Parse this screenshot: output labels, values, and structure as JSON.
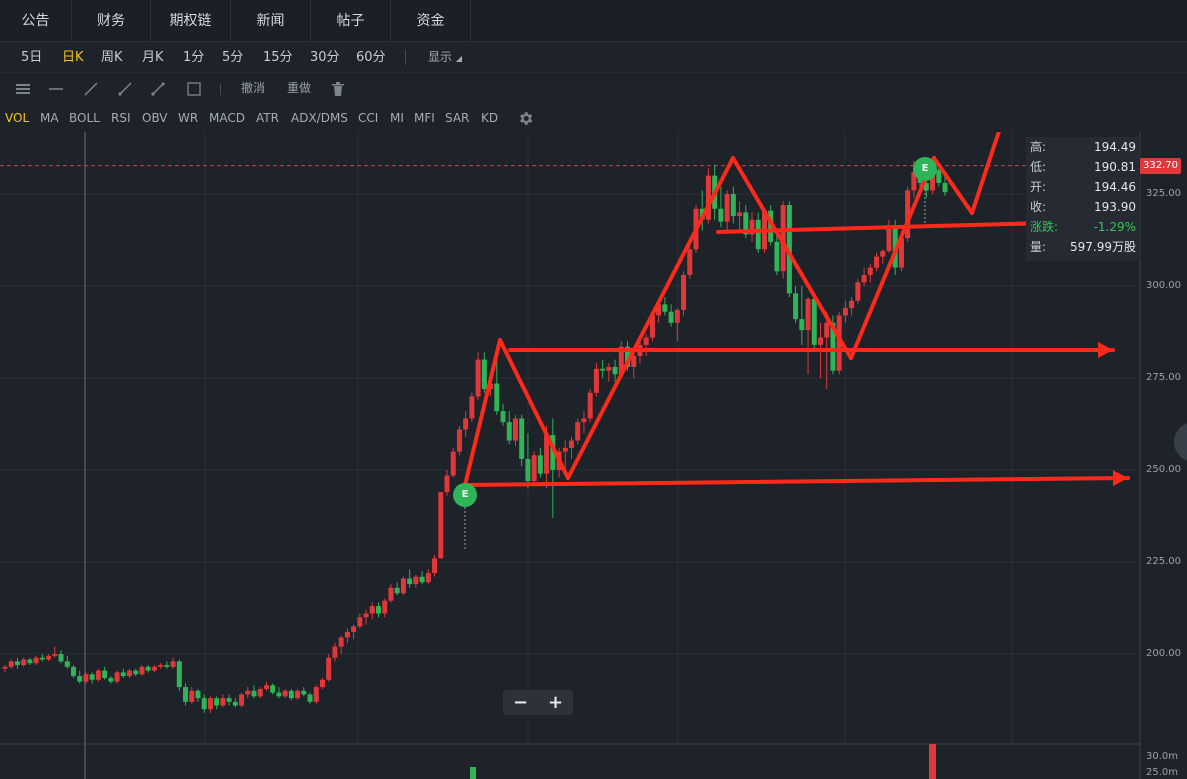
{
  "nav": {
    "tabs": [
      "公告",
      "财务",
      "期权链",
      "新闻",
      "帖子",
      "资金"
    ]
  },
  "periods": {
    "items": [
      "5日",
      "日K",
      "周K",
      "月K",
      "1分",
      "5分",
      "15分",
      "30分",
      "60分"
    ],
    "active": "日K",
    "display_label": "显示"
  },
  "drawtools": {
    "undo": "撤消",
    "redo": "重做"
  },
  "indicators": {
    "items": [
      "VOL",
      "MA",
      "BOLL",
      "RSI",
      "OBV",
      "WR",
      "MACD",
      "ATR",
      "ADX/DMS",
      "CCI",
      "MI",
      "MFI",
      "SAR",
      "KD"
    ],
    "active": "VOL"
  },
  "info": {
    "high_label": "高:",
    "high": "194.49",
    "low_label": "低:",
    "low": "190.81",
    "open_label": "开:",
    "open": "194.46",
    "close_label": "收:",
    "close": "193.90",
    "change_label": "涨跌:",
    "change": "-1.29%",
    "volume_label": "量:",
    "volume": "597.99万股"
  },
  "price_tag": "332.70",
  "yaxis": {
    "ticks": [
      "325.00",
      "300.00",
      "275.00",
      "250.00",
      "225.00",
      "200.00"
    ],
    "volume_ticks": [
      "30.0m",
      "25.0m"
    ]
  },
  "markers": {
    "earnings": "E"
  },
  "zoom": {
    "minus": "−",
    "plus": "+"
  },
  "colors": {
    "up": "#e0383a",
    "down": "#2fb457",
    "annotation": "#ff2a1a",
    "background": "#1e2229"
  },
  "chart_data": {
    "type": "candlestick",
    "ylim": [
      180,
      337
    ],
    "yticks": [
      200,
      225,
      250,
      275,
      300,
      325
    ],
    "reference_price": 332.7,
    "candles": [
      [
        196.0,
        197.0,
        195.0,
        196.5
      ],
      [
        196.5,
        198.5,
        196.0,
        198.0
      ],
      [
        198.0,
        199.0,
        196.0,
        197.0
      ],
      [
        197.0,
        199.0,
        196.5,
        198.5
      ],
      [
        198.5,
        199.0,
        197.0,
        197.5
      ],
      [
        197.5,
        199.5,
        197.0,
        199.0
      ],
      [
        199.0,
        200.0,
        198.0,
        198.5
      ],
      [
        198.5,
        200.0,
        198.0,
        199.5
      ],
      [
        199.5,
        202.0,
        199.0,
        200.0
      ],
      [
        200.0,
        201.0,
        197.5,
        198.0
      ],
      [
        198.0,
        199.5,
        196.0,
        196.5
      ],
      [
        196.5,
        197.0,
        193.5,
        194.0
      ],
      [
        194.0,
        195.5,
        192.0,
        192.5
      ],
      [
        192.5,
        195.0,
        192.0,
        194.5
      ],
      [
        194.5,
        195.0,
        192.0,
        193.0
      ],
      [
        193.0,
        196.0,
        192.5,
        195.5
      ],
      [
        195.5,
        196.5,
        193.0,
        193.5
      ],
      [
        193.5,
        194.0,
        192.0,
        192.5
      ],
      [
        192.5,
        195.5,
        192.0,
        195.0
      ],
      [
        195.0,
        196.0,
        193.5,
        194.0
      ],
      [
        194.0,
        196.0,
        193.5,
        195.5
      ],
      [
        195.5,
        196.0,
        194.0,
        194.5
      ],
      [
        194.5,
        197.0,
        194.0,
        196.5
      ],
      [
        196.5,
        197.0,
        195.0,
        195.5
      ],
      [
        195.5,
        197.0,
        195.0,
        196.5
      ],
      [
        196.5,
        197.5,
        196.0,
        197.0
      ],
      [
        197.0,
        198.0,
        196.0,
        196.5
      ],
      [
        196.5,
        199.0,
        196.0,
        198.0
      ],
      [
        198.0,
        198.5,
        190.0,
        191.0
      ],
      [
        191.0,
        192.0,
        186.0,
        187.0
      ],
      [
        187.0,
        191.0,
        186.5,
        190.0
      ],
      [
        190.0,
        190.5,
        187.0,
        188.0
      ],
      [
        188.0,
        189.0,
        184.0,
        185.0
      ],
      [
        185.0,
        188.5,
        184.0,
        188.0
      ],
      [
        188.0,
        188.5,
        185.0,
        186.0
      ],
      [
        186.0,
        189.0,
        185.5,
        188.0
      ],
      [
        188.0,
        189.0,
        186.0,
        187.0
      ],
      [
        187.0,
        188.0,
        185.5,
        186.0
      ],
      [
        186.0,
        189.5,
        185.5,
        189.0
      ],
      [
        189.0,
        191.0,
        188.0,
        190.0
      ],
      [
        190.0,
        191.5,
        188.0,
        188.5
      ],
      [
        188.5,
        191.0,
        188.0,
        190.5
      ],
      [
        190.5,
        192.5,
        190.0,
        191.5
      ],
      [
        191.5,
        192.0,
        189.0,
        189.5
      ],
      [
        189.5,
        191.0,
        188.0,
        188.5
      ],
      [
        188.5,
        190.5,
        188.0,
        190.0
      ],
      [
        190.0,
        190.5,
        187.5,
        188.0
      ],
      [
        188.0,
        190.5,
        187.5,
        190.0
      ],
      [
        190.0,
        191.0,
        188.5,
        189.0
      ],
      [
        189.0,
        189.5,
        186.5,
        187.0
      ],
      [
        187.0,
        191.5,
        186.5,
        191.0
      ],
      [
        191.0,
        193.5,
        190.5,
        193.0
      ],
      [
        193.0,
        200.0,
        192.5,
        199.0
      ],
      [
        199.0,
        203.0,
        198.0,
        202.0
      ],
      [
        202.0,
        205.0,
        200.0,
        204.5
      ],
      [
        204.5,
        207.0,
        203.0,
        206.0
      ],
      [
        206.0,
        208.0,
        204.0,
        207.5
      ],
      [
        207.5,
        211.0,
        207.0,
        210.0
      ],
      [
        210.0,
        212.0,
        208.0,
        211.0
      ],
      [
        211.0,
        214.0,
        209.5,
        213.0
      ],
      [
        213.0,
        214.0,
        210.0,
        211.0
      ],
      [
        211.0,
        215.0,
        210.0,
        214.5
      ],
      [
        214.5,
        219.0,
        214.0,
        218.0
      ],
      [
        218.0,
        219.5,
        216.0,
        216.5
      ],
      [
        216.5,
        221.0,
        216.0,
        220.5
      ],
      [
        220.5,
        223.0,
        218.0,
        219.0
      ],
      [
        219.0,
        221.5,
        218.0,
        221.0
      ],
      [
        221.0,
        222.5,
        219.0,
        219.5
      ],
      [
        219.5,
        223.0,
        219.0,
        222.0
      ],
      [
        222.0,
        227.0,
        221.0,
        226.0
      ],
      [
        226.0,
        226.5,
        244.0,
        244.0
      ],
      [
        244.0,
        250.0,
        243.0,
        248.5
      ],
      [
        248.5,
        256.0,
        248.0,
        255.0
      ],
      [
        255.0,
        262.0,
        254.0,
        261.0
      ],
      [
        261.0,
        266.0,
        259.0,
        264.0
      ],
      [
        264.0,
        271.0,
        263.0,
        270.0
      ],
      [
        270.0,
        282.0,
        269.0,
        280.0
      ],
      [
        280.0,
        282.0,
        271.0,
        272.0
      ],
      [
        272.0,
        275.0,
        270.0,
        273.5
      ],
      [
        273.5,
        282.0,
        265.0,
        266.0
      ],
      [
        266.0,
        268.0,
        262.0,
        263.0
      ],
      [
        263.0,
        266.0,
        257.0,
        258.0
      ],
      [
        258.0,
        265.0,
        256.5,
        264.0
      ],
      [
        264.0,
        265.0,
        251.0,
        253.0
      ],
      [
        253.0,
        260.0,
        245.0,
        247.0
      ],
      [
        247.0,
        255.0,
        246.0,
        254.0
      ],
      [
        254.0,
        256.0,
        248.0,
        249.0
      ],
      [
        249.0,
        262.0,
        245.0,
        259.5
      ],
      [
        259.5,
        264.0,
        237.0,
        250.0
      ],
      [
        250.0,
        256.0,
        248.0,
        255.0
      ],
      [
        255.0,
        258.0,
        250.0,
        256.0
      ],
      [
        256.0,
        259.0,
        253.0,
        258.0
      ],
      [
        258.0,
        264.0,
        257.0,
        263.0
      ],
      [
        263.0,
        266.0,
        260.0,
        264.0
      ],
      [
        264.0,
        272.0,
        263.0,
        271.0
      ],
      [
        271.0,
        279.0,
        270.0,
        277.5
      ],
      [
        277.5,
        280.0,
        275.0,
        277.0
      ],
      [
        277.0,
        279.0,
        274.0,
        278.0
      ],
      [
        278.0,
        280.0,
        274.0,
        276.0
      ],
      [
        276.0,
        285.0,
        275.0,
        283.5
      ],
      [
        283.5,
        285.0,
        277.0,
        278.0
      ],
      [
        278.0,
        282.0,
        275.0,
        281.0
      ],
      [
        281.0,
        285.0,
        279.0,
        284.0
      ],
      [
        284.0,
        287.0,
        281.0,
        286.0
      ],
      [
        286.0,
        293.0,
        285.0,
        292.0
      ],
      [
        292.0,
        296.0,
        290.0,
        295.0
      ],
      [
        295.0,
        297.0,
        292.0,
        293.0
      ],
      [
        293.0,
        295.0,
        289.0,
        290.0
      ],
      [
        290.0,
        294.0,
        285.0,
        293.5
      ],
      [
        293.5,
        304.0,
        292.0,
        303.0
      ],
      [
        303.0,
        311.0,
        302.0,
        310.0
      ],
      [
        310.0,
        322.0,
        309.0,
        321.0
      ],
      [
        321.0,
        326.0,
        315.0,
        318.0
      ],
      [
        318.0,
        332.0,
        317.0,
        330.0
      ],
      [
        330.0,
        333.0,
        318.0,
        321.0
      ],
      [
        321.0,
        327.0,
        316.0,
        317.5
      ],
      [
        317.5,
        326.0,
        315.0,
        325.0
      ],
      [
        325.0,
        327.0,
        317.0,
        319.0
      ],
      [
        319.0,
        323.0,
        315.0,
        320.0
      ],
      [
        320.0,
        322.0,
        313.0,
        314.0
      ],
      [
        314.0,
        320.0,
        312.0,
        318.0
      ],
      [
        318.0,
        320.0,
        309.0,
        310.0
      ],
      [
        310.0,
        321.0,
        309.0,
        320.5
      ],
      [
        320.5,
        322.0,
        311.0,
        312.0
      ],
      [
        312.0,
        314.0,
        303.0,
        304.0
      ],
      [
        304.0,
        323.0,
        302.0,
        322.0
      ],
      [
        322.0,
        323.0,
        297.0,
        298.0
      ],
      [
        298.0,
        300.0,
        290.0,
        291.0
      ],
      [
        291.0,
        300.0,
        284.0,
        288.0
      ],
      [
        288.0,
        297.0,
        276.0,
        296.5
      ],
      [
        296.5,
        298.0,
        283.0,
        284.0
      ],
      [
        284.0,
        290.0,
        275.0,
        286.0
      ],
      [
        286.0,
        293.0,
        272.0,
        290.0
      ],
      [
        290.0,
        292.0,
        276.0,
        277.0
      ],
      [
        277.0,
        293.0,
        276.0,
        292.0
      ],
      [
        292.0,
        296.0,
        290.0,
        294.0
      ],
      [
        294.0,
        297.0,
        292.0,
        296.0
      ],
      [
        296.0,
        302.0,
        295.0,
        301.0
      ],
      [
        301.0,
        305.0,
        300.0,
        303.0
      ],
      [
        303.0,
        306.0,
        301.0,
        305.0
      ],
      [
        305.0,
        309.0,
        304.0,
        308.0
      ],
      [
        308.0,
        310.0,
        306.0,
        309.5
      ],
      [
        309.5,
        318.0,
        309.0,
        316.5
      ],
      [
        316.5,
        318.0,
        303.0,
        305.0
      ],
      [
        305.0,
        315.0,
        304.0,
        313.0
      ],
      [
        313.0,
        327.0,
        312.0,
        326.0
      ],
      [
        326.0,
        334.0,
        324.0,
        331.0
      ],
      [
        331.0,
        334.0,
        326.0,
        328.0
      ],
      [
        328.0,
        332.0,
        324.0,
        326.0
      ],
      [
        326.0,
        332.5,
        325.0,
        331.5
      ],
      [
        331.5,
        333.0,
        327.0,
        328.0
      ],
      [
        328.0,
        330.0,
        324.5,
        325.5
      ]
    ]
  }
}
